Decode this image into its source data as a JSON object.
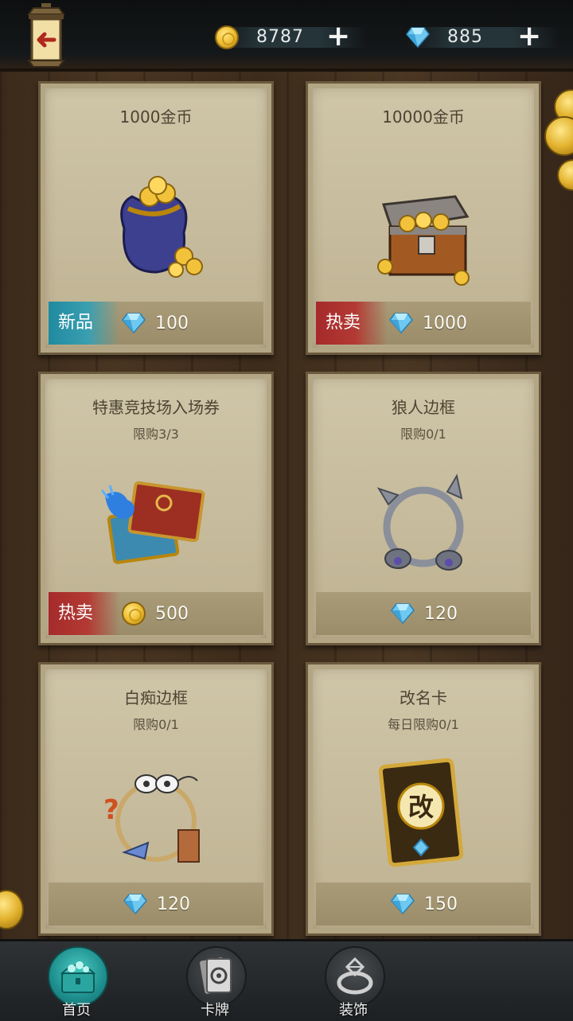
{
  "header": {
    "gold": "8787",
    "gems": "885"
  },
  "items": [
    {
      "title": "1000金币",
      "limit": "",
      "tag": "新品",
      "tag_type": "new",
      "currency": "gem",
      "price": "100",
      "art": "gold-bag-icon"
    },
    {
      "title": "10000金币",
      "limit": "",
      "tag": "热卖",
      "tag_type": "hot",
      "currency": "gem",
      "price": "1000",
      "art": "treasure-chest-icon"
    },
    {
      "title": "特惠竞技场入场券",
      "limit": "限购3/3",
      "tag": "热卖",
      "tag_type": "hot",
      "currency": "gold",
      "price": "500",
      "art": "arena-ticket-icon"
    },
    {
      "title": "狼人边框",
      "limit": "限购0/1",
      "tag": "",
      "tag_type": "",
      "currency": "gem",
      "price": "120",
      "art": "werewolf-frame-icon"
    },
    {
      "title": "白痴边框",
      "limit": "限购0/1",
      "tag": "",
      "tag_type": "",
      "currency": "gem",
      "price": "120",
      "art": "idiot-frame-icon"
    },
    {
      "title": "改名卡",
      "limit": "每日限购0/1",
      "tag": "",
      "tag_type": "",
      "currency": "gem",
      "price": "150",
      "art": "rename-card-icon"
    }
  ],
  "rename_card_glyph": "改",
  "nav": [
    {
      "label": "首页",
      "icon": "chest-icon",
      "active": true
    },
    {
      "label": "卡牌",
      "icon": "card-icon",
      "active": false
    },
    {
      "label": "装饰",
      "icon": "ring-icon",
      "active": false
    }
  ],
  "colors": {
    "new_tag": "#1f8aa0",
    "hot_tag": "#a52a2a",
    "active_nav": "#1e8f8e"
  }
}
